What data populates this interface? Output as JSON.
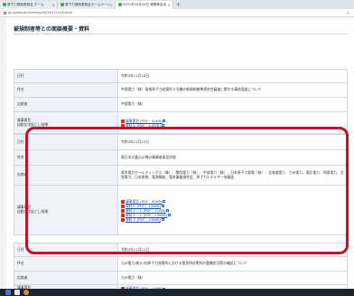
{
  "browser": {
    "tabs": [
      {
        "label": "原子力規制委員会 ホーム",
        "active": false
      },
      {
        "label": "原子力規制委員会ホームページ",
        "active": false
      },
      {
        "label": "2021年10月16日 東電等会合",
        "active": true
      }
    ],
    "new_tab": "+",
    "url": "go.jp/about/meeting/05/20211016.html",
    "right_icon": "G"
  },
  "page": {
    "title": "被規制者等との面談概要・資料"
  },
  "tables": [
    {
      "rows": [
        {
          "label": "日付",
          "value": "令和3年11月16日"
        },
        {
          "label": "件名",
          "value": "中国電力（株）島根原子力発電所２号機の新規制基準適合性審査に関する事前面談について"
        },
        {
          "label": "出席者",
          "value": "中国電力（株）"
        },
        {
          "label": "議事要旨\n自動文字起こし結果",
          "docs": [
            "議事要旨 [PDF：62KB]",
            "資料１ [PDF：4.0MB]"
          ]
        }
      ]
    },
    {
      "rows": [
        {
          "label": "日付",
          "value": "令和3年11月15日"
        },
        {
          "label": "件名",
          "value": "東日本大震災以降の事業者意見交換"
        },
        {
          "label": "出席者",
          "value": "東京電力ホールディングス（株）、関西電力（株）、中部電力（株）、日本原子力発電（株）、北海道電力、九州電力、東北電力、四国電力、北陸電力、日本原燃、電源開発、電気事業連合会、原子力エネルギー協議会"
        },
        {
          "label": "議事要旨\n自動文字起こし結果",
          "docs": [
            "議事要旨 [PDF：62KB]",
            "資料１ [PDF：436KB]",
            "資料２−１ [PDF：11MB]",
            "資料２−２ [PDF：136KB]",
            "資料３ [PDF：436KB]"
          ]
        }
      ]
    },
    {
      "rows": [
        {
          "label": "日付",
          "value": "令和3年11月12日"
        },
        {
          "label": "件名",
          "value": "九州電力(株)川内原子力発電所における緊急時対策所の整備状況等の確認について"
        },
        {
          "label": "出席者",
          "value": "九州電力（株）"
        },
        {
          "label": "議事要旨",
          "docs": [
            "議事要旨 [PDF：47KB]"
          ]
        }
      ]
    }
  ],
  "colors": {
    "highlight": "#c5102b",
    "link": "#1a4fa0",
    "header_bg": "#eef2f6"
  }
}
